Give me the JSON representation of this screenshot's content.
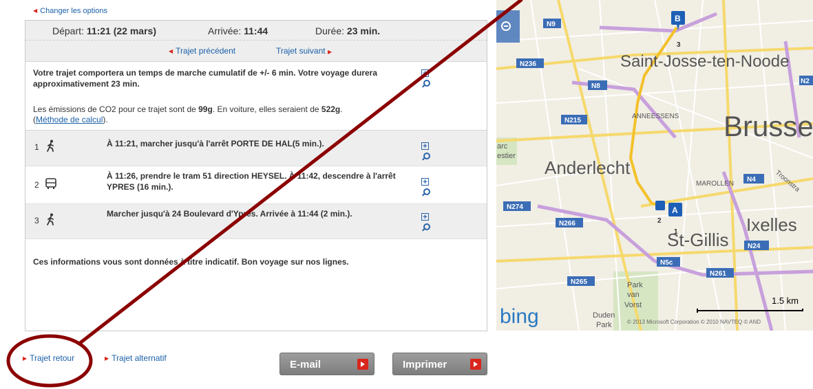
{
  "links": {
    "changer": "Changer les options",
    "prev": "Trajet précédent",
    "next": "Trajet suivant",
    "retour": "Trajet retour",
    "alternatif": "Trajet alternatif",
    "method": "Méthode de calcul"
  },
  "times": {
    "depart_label": "Départ:",
    "depart_value": "11:21 (22 mars)",
    "arrivee_label": "Arrivée:",
    "arrivee_value": "11:44",
    "duree_label": "Durée:",
    "duree_value": "23 min."
  },
  "summary": {
    "walk_text": "Votre trajet comportera un temps de marche cumulatif de +/- 6 min. Votre voyage durera approximativement 23 min.",
    "co2_a": "Les émissions de CO2 pour ce trajet sont de ",
    "co2_val1": "99g",
    "co2_b": ". En voiture, elles seraient de ",
    "co2_val2": "522g",
    "co2_c": ".",
    "paren_open": "(",
    "paren_close": ")."
  },
  "steps": [
    {
      "num": "1",
      "mode": "walk-icon",
      "text": "À 11:21, marcher jusqu'à l'arrêt PORTE DE HAL(5 min.)."
    },
    {
      "num": "2",
      "mode": "tram-icon",
      "text": "À 11:26, prendre le tram 51 direction HEYSEL. À 11:42, descendre à l'arrêt YPRES (16 min.)."
    },
    {
      "num": "3",
      "mode": "walk-icon",
      "text": "Marcher jusqu'à 24 Boulevard d'Ypres. Arrivée à 11:44 (2 min.)."
    }
  ],
  "closing": "Ces informations vous sont données à titre indicatif. Bon voyage sur nos lignes.",
  "buttons": {
    "email": "E-mail",
    "print": "Imprimer"
  },
  "map": {
    "places": [
      "Saint-Josse-ten-Noode",
      "Brusse",
      "Anderlecht",
      "Ixelles",
      "St-Gillis",
      "ANNEESSENS",
      "MAROLLEN",
      "Troonstra",
      "arc",
      "estier",
      "Park",
      "van",
      "Vorst",
      "Duden",
      "Park"
    ],
    "roads": [
      "N9",
      "N236",
      "N8",
      "N2",
      "N215",
      "N274",
      "N266",
      "N4",
      "N24",
      "N5c",
      "N261",
      "N265"
    ],
    "markers": {
      "a": "A",
      "b": "B",
      "n1": "1",
      "n2": "2",
      "n3": "3"
    },
    "scale": "1.5 km",
    "logo": "bing",
    "copyright": "© 2013 Microsoft Corporation   © 2010 NAVTEQ   © AND"
  },
  "colors": {
    "accent": "#d9261c",
    "link": "#1a5fa8",
    "annotation": "#8b0000"
  }
}
